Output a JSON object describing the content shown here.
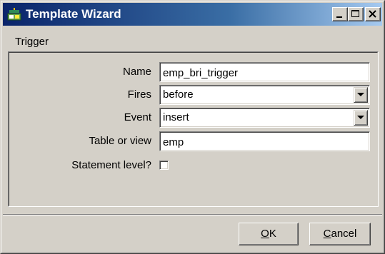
{
  "window": {
    "title": "Template Wizard",
    "title_icon": "wizard-app-icon"
  },
  "title_buttons": {
    "minimize_icon": "minimize-icon",
    "maximize_icon": "maximize-icon",
    "close_icon": "close-icon"
  },
  "section": {
    "label": "Trigger"
  },
  "form": {
    "name": {
      "label": "Name",
      "value": "emp_bri_trigger"
    },
    "fires": {
      "label": "Fires",
      "value": "before"
    },
    "event": {
      "label": "Event",
      "value": "insert"
    },
    "table_or_view": {
      "label": "Table or view",
      "value": "emp"
    },
    "statement_level": {
      "label": "Statement level?",
      "checked": false
    }
  },
  "buttons": {
    "ok": {
      "mnemonic": "O",
      "rest": "K"
    },
    "cancel": {
      "mnemonic": "C",
      "rest": "ancel"
    }
  },
  "colors": {
    "title_gradient_start": "#0a246a",
    "title_gradient_end": "#a6caf0",
    "face": "#d4d0c8"
  }
}
